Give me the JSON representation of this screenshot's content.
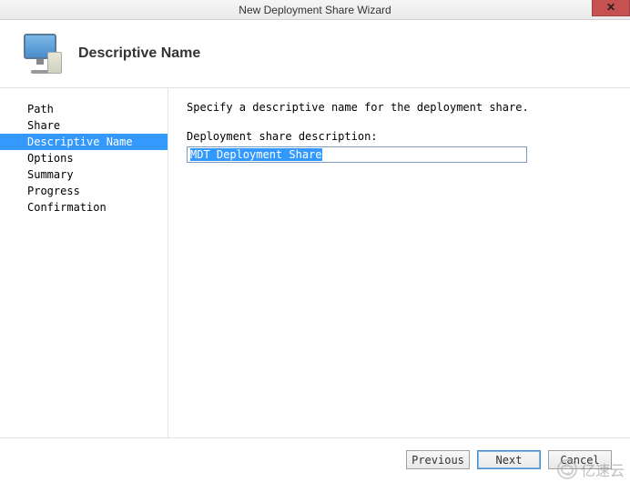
{
  "window": {
    "title": "New Deployment Share Wizard",
    "close_label": "✕"
  },
  "header": {
    "title": "Descriptive Name"
  },
  "sidebar": {
    "items": [
      {
        "label": "Path",
        "active": false
      },
      {
        "label": "Share",
        "active": false
      },
      {
        "label": "Descriptive Name",
        "active": true
      },
      {
        "label": "Options",
        "active": false
      },
      {
        "label": "Summary",
        "active": false
      },
      {
        "label": "Progress",
        "active": false
      },
      {
        "label": "Confirmation",
        "active": false
      }
    ]
  },
  "content": {
    "instruction": "Specify a descriptive name for the deployment share.",
    "field_label": "Deployment share description:",
    "field_value": "MDT Deployment Share"
  },
  "footer": {
    "previous": "Previous",
    "next": "Next",
    "cancel": "Cancel"
  },
  "watermark": {
    "text": "亿速云"
  }
}
